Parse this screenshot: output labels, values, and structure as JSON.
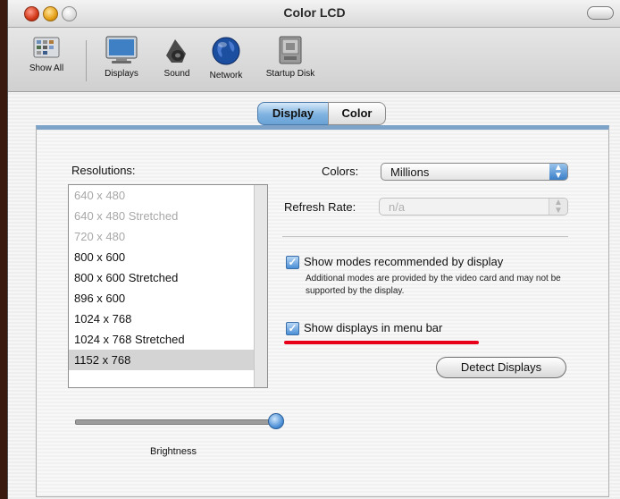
{
  "window": {
    "title": "Color LCD"
  },
  "toolbar": {
    "items": [
      {
        "label": "Show All",
        "icon": "show-all-icon"
      },
      {
        "label": "Displays",
        "icon": "displays-icon"
      },
      {
        "label": "Sound",
        "icon": "sound-icon"
      },
      {
        "label": "Network",
        "icon": "network-icon"
      },
      {
        "label": "Startup Disk",
        "icon": "startup-disk-icon"
      }
    ]
  },
  "tabs": [
    {
      "label": "Display",
      "selected": true
    },
    {
      "label": "Color",
      "selected": false
    }
  ],
  "resolutions": {
    "label": "Resolutions:",
    "items": [
      {
        "text": "640 x 480",
        "state": "disabled"
      },
      {
        "text": "640 x 480 Stretched",
        "state": "disabled"
      },
      {
        "text": "720 x 480",
        "state": "disabled"
      },
      {
        "text": "800 x 600",
        "state": "normal"
      },
      {
        "text": "800 x 600 Stretched",
        "state": "normal"
      },
      {
        "text": "896 x 600",
        "state": "normal"
      },
      {
        "text": "1024 x 768",
        "state": "normal"
      },
      {
        "text": "1024 x 768 Stretched",
        "state": "normal"
      },
      {
        "text": "1152 x 768",
        "state": "selected"
      }
    ]
  },
  "colors": {
    "label": "Colors:",
    "value": "Millions"
  },
  "refresh": {
    "label": "Refresh Rate:",
    "value": "n/a"
  },
  "options": {
    "show_recommended": {
      "label": "Show modes recommended by display",
      "checked": true
    },
    "note": "Additional modes are provided by the video card and may not be supported by the display.",
    "show_in_menu_bar": {
      "label": "Show displays in menu bar",
      "checked": true
    }
  },
  "buttons": {
    "detect": "Detect Displays"
  },
  "brightness": {
    "label": "Brightness",
    "level": 1.0
  },
  "colors_theme": {
    "accent": "#6aa2d6",
    "highlight_line": "#e8001a"
  }
}
